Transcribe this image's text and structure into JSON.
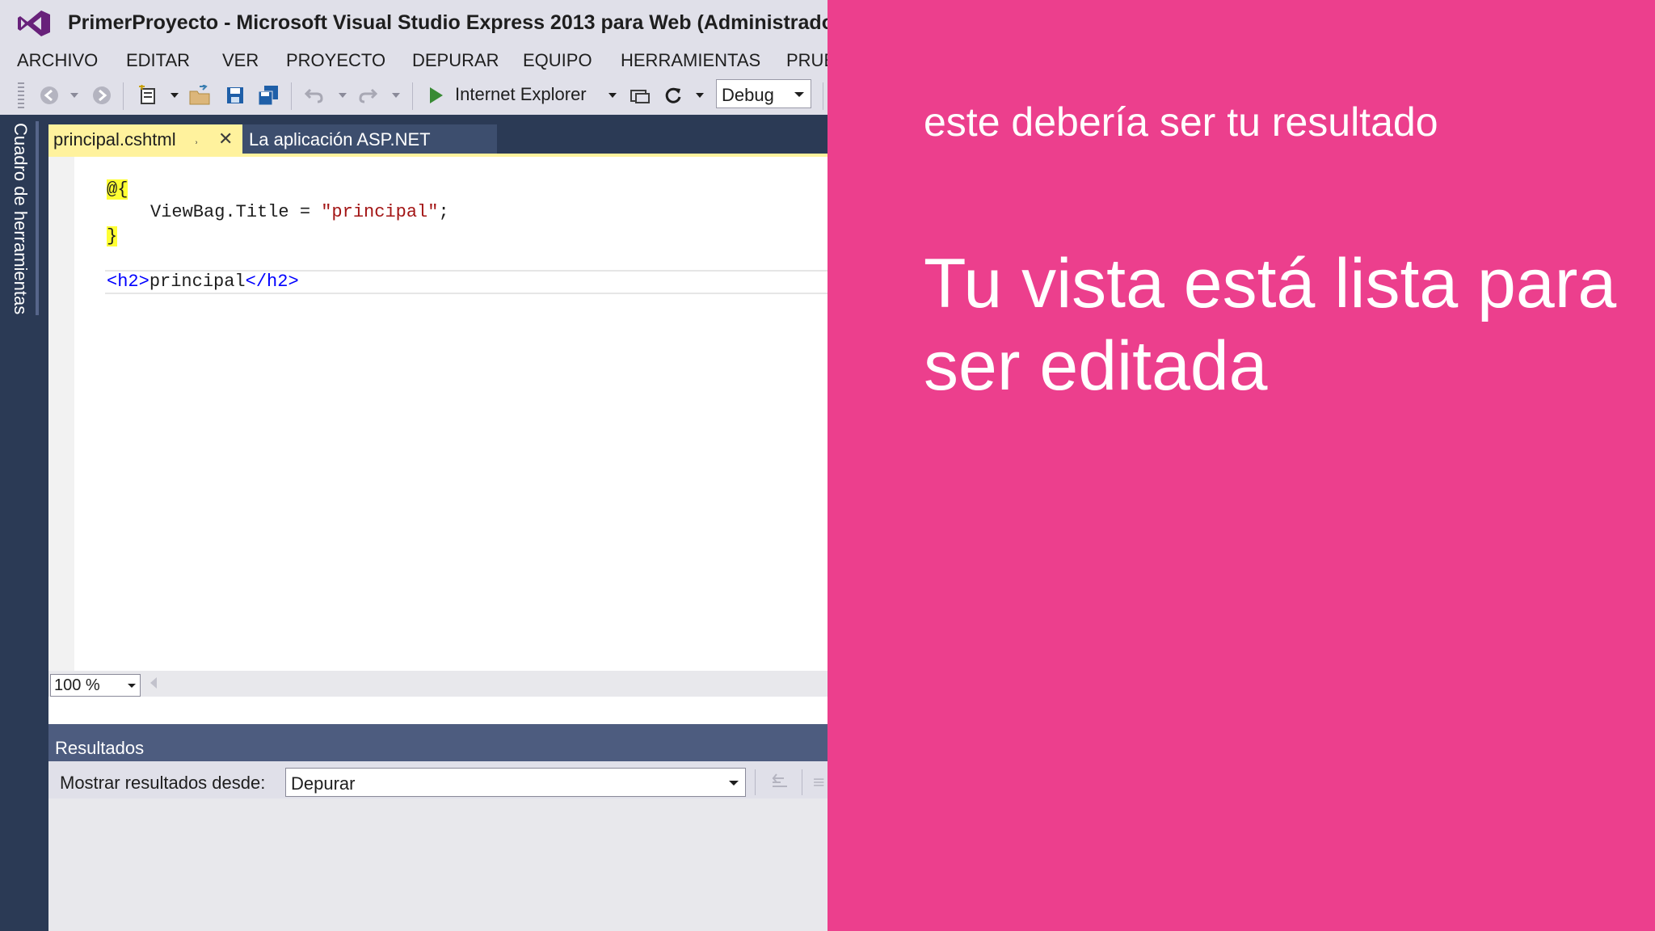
{
  "window": {
    "title": "PrimerProyecto - Microsoft Visual Studio Express 2013 para Web (Administrador"
  },
  "menu": [
    "ARCHIVO",
    "EDITAR",
    "VER",
    "PROYECTO",
    "DEPURAR",
    "EQUIPO",
    "HERRAMIENTAS",
    "PRUE"
  ],
  "toolbar": {
    "run_target": "Internet Explorer",
    "configuration": "Debug"
  },
  "side_panel": {
    "toolbox_label": "Cuadro de herramientas"
  },
  "tabs": [
    {
      "label": "principal.cshtml",
      "active": true
    },
    {
      "label": "La aplicación ASP.NET",
      "active": false
    }
  ],
  "editor": {
    "line1_open": "@{",
    "line2_lhs": "ViewBag.Title = ",
    "line2_string": "\"principal\"",
    "line2_end": ";",
    "line3_close": "}",
    "line4_tag_open": "<h2>",
    "line4_text": "principal",
    "line4_tag_close": "</h2>",
    "zoom": "100 %"
  },
  "output": {
    "title": "Resultados",
    "show_from_label": "Mostrar resultados desde:",
    "show_from_value": "Depurar"
  },
  "overlay": {
    "subtitle": "este debería ser tu resultado",
    "headline": "Tu vista está lista para ser editada",
    "background": "#ec3f8d"
  },
  "colors": {
    "active_tab": "#fff29d",
    "chrome": "#e0e0e9",
    "dark_panel": "#2b3a55"
  }
}
